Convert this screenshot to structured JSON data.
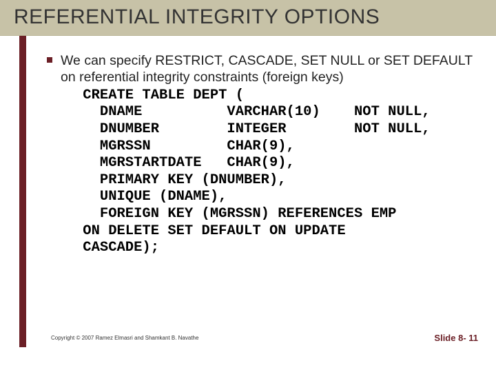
{
  "title": "REFERENTIAL INTEGRITY OPTIONS",
  "lead": "We can specify RESTRICT, CASCADE, SET NULL or SET DEFAULT on referential integrity constraints (foreign keys)",
  "code": " CREATE TABLE DEPT (\n   DNAME          VARCHAR(10)    NOT NULL,\n   DNUMBER        INTEGER        NOT NULL,\n   MGRSSN         CHAR(9),\n   MGRSTARTDATE   CHAR(9),\n   PRIMARY KEY (DNUMBER),\n   UNIQUE (DNAME),\n   FOREIGN KEY (MGRSSN) REFERENCES EMP\n ON DELETE SET DEFAULT ON UPDATE\n CASCADE);",
  "copyright": "Copyright © 2007 Ramez Elmasri and Shamkant B. Navathe",
  "slidenum": "Slide 8- 11"
}
